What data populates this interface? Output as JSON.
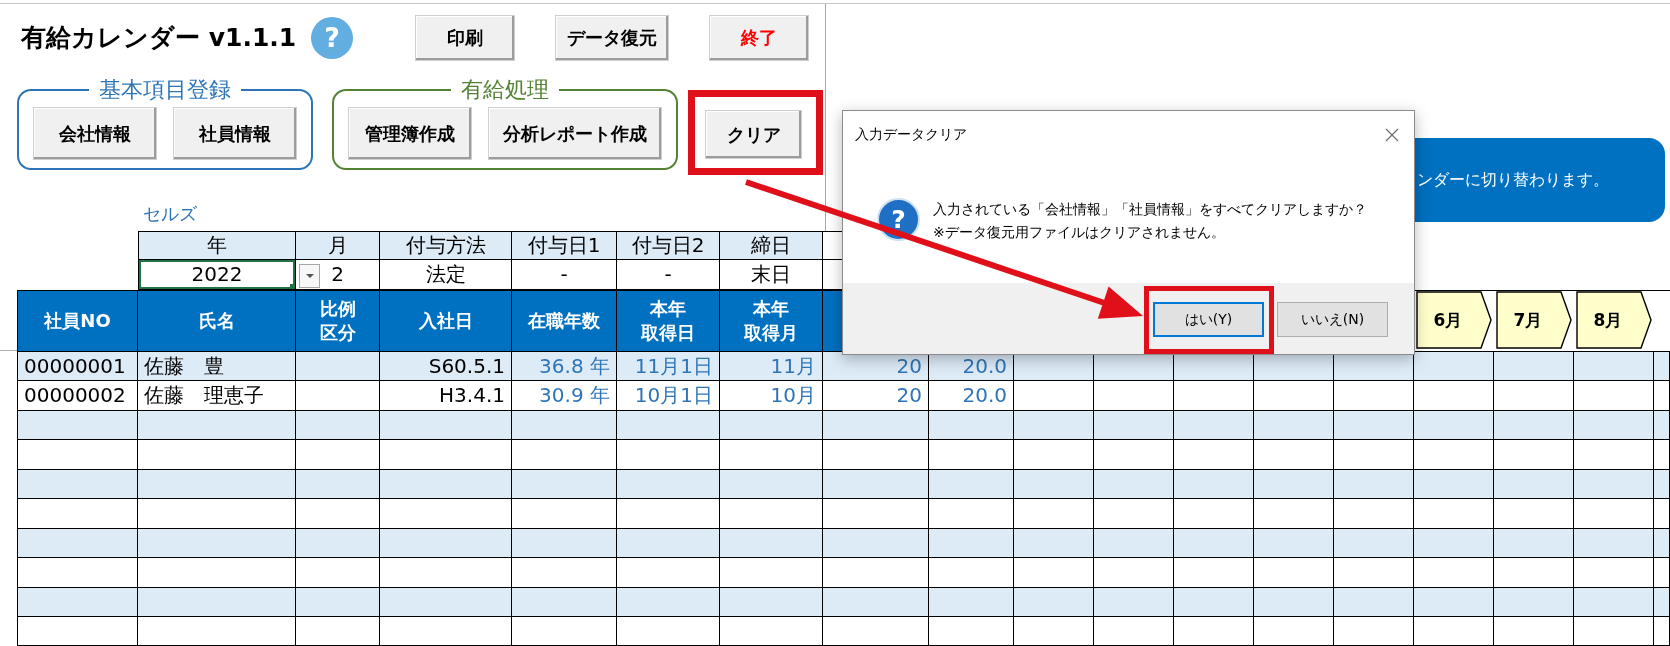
{
  "app": {
    "title": "有給カレンダー v1.1.1",
    "help_button": "?"
  },
  "top_buttons": [
    {
      "label": "印刷",
      "kind": "normal"
    },
    {
      "label": "データ復元",
      "kind": "normal"
    },
    {
      "label": "終了",
      "kind": "exit"
    }
  ],
  "groups": [
    {
      "title": "基本項目登録",
      "color": "#2e75b6",
      "buttons": [
        "会社情報",
        "社員情報"
      ]
    },
    {
      "title": "有給処理",
      "color": "#548235",
      "buttons": [
        "管理簿作成",
        "分析レポート作成"
      ]
    }
  ],
  "clear_button": {
    "label": "クリア",
    "highlighted": true
  },
  "sheet_label": "セルズ",
  "settings_table": {
    "columns": [
      "年",
      "月",
      "付与方法",
      "付与日1",
      "付与日2",
      "締日"
    ],
    "values": [
      {
        "text": "2022",
        "selected": true
      },
      {
        "text": "2",
        "selected": false
      },
      {
        "text": "法定",
        "selected": false
      },
      {
        "text": "-",
        "selected": false
      },
      {
        "text": "-",
        "selected": false
      },
      {
        "text": "末日",
        "selected": false
      }
    ]
  },
  "callout": {
    "text": "ンダーに切り替わります。"
  },
  "table": {
    "columns": [
      "社員NO",
      "氏名",
      "比例区分",
      "入社日",
      "在職年数",
      "本年取得日",
      "本年取得月"
    ],
    "month_tabs": [
      "6月",
      "7月",
      "8月"
    ],
    "rows": [
      {
        "employee_no": "00000001",
        "name": "佐藤　豊",
        "hire_date": "S60.5.1",
        "years_of_service": "36.8 年",
        "grant_date": "11月1日",
        "grant_month": "11月",
        "column_8": "20",
        "column_9": "20.0"
      },
      {
        "employee_no": "00000002",
        "name": "佐藤　理恵子",
        "hire_date": "H3.4.1",
        "years_of_service": "30.9 年",
        "grant_date": "10月1日",
        "grant_month": "10月",
        "column_8": "20",
        "column_9": "20.0"
      }
    ]
  },
  "dialog": {
    "title": "入力データクリア",
    "icon": "?",
    "message": [
      "入力されている「会社情報」「社員情報」をすべてクリアしますか？",
      "※データ復元用ファイルはクリアされません。"
    ],
    "buttons": [
      {
        "label": "はい(Y)",
        "default": true,
        "highlighted": true
      },
      {
        "label": "いいえ(N)",
        "default": false,
        "highlighted": false
      }
    ]
  }
}
